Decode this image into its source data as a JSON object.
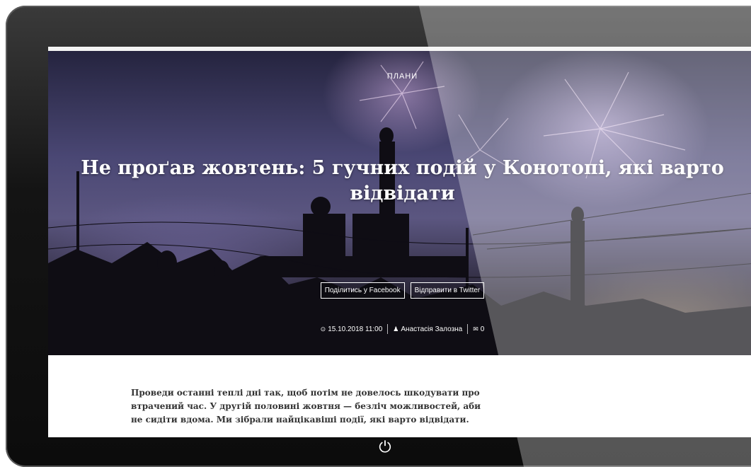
{
  "hero": {
    "category": "плани",
    "title": "Не проґав жовтень: 5 гучних подій у Конотопі, які варто відвідати",
    "share_facebook": "Поділитись у Facebook",
    "share_twitter": "Відправити в Twitter",
    "meta": {
      "date": "15.10.2018 11:00",
      "author": "Анастасія Залозна",
      "comments": "0"
    }
  },
  "article": {
    "lead": "Проведи останні теплі дні так, щоб потім не довелось шкодувати про втрачений час. У другій половині жовтня — безліч можливостей, аби не сидіти вдома. Ми зібрали найцікавіші події, які варто відвідати."
  },
  "icons": {
    "clock": "clock-icon",
    "user": "user-icon",
    "comment": "comment-icon",
    "power": "power-icon"
  }
}
